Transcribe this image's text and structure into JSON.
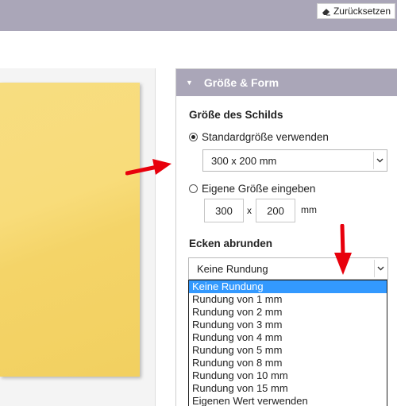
{
  "toolbar": {
    "reset_label": "Zurücksetzen",
    "reset_icon": "eraser-icon"
  },
  "panel": {
    "title": "Größe & Form",
    "size_section_title": "Größe des Schilds",
    "standard_radio_label": "Standardgröße verwenden",
    "standard_radio_checked": true,
    "standard_size_value": "300 x 200 mm",
    "custom_radio_label": "Eigene Größe eingeben",
    "custom_radio_checked": false,
    "custom_width": "300",
    "times_sign": "x",
    "custom_height": "200",
    "unit": "mm",
    "corners_section_title": "Ecken abrunden",
    "corner_select_value": "Keine Rundung",
    "corner_options": [
      "Keine Rundung",
      "Rundung von 1 mm",
      "Rundung von 2 mm",
      "Rundung von 3 mm",
      "Rundung von 4 mm",
      "Rundung von 5 mm",
      "Rundung von 8 mm",
      "Rundung von 10 mm",
      "Rundung von 15 mm",
      "Eigenen Wert verwenden"
    ],
    "highlighted_option_index": 0
  },
  "colors": {
    "header_bg": "#aaa6b8",
    "highlight": "#3399ff",
    "sign_fill": "#f7dd80",
    "arrow_red": "#e8000c"
  }
}
